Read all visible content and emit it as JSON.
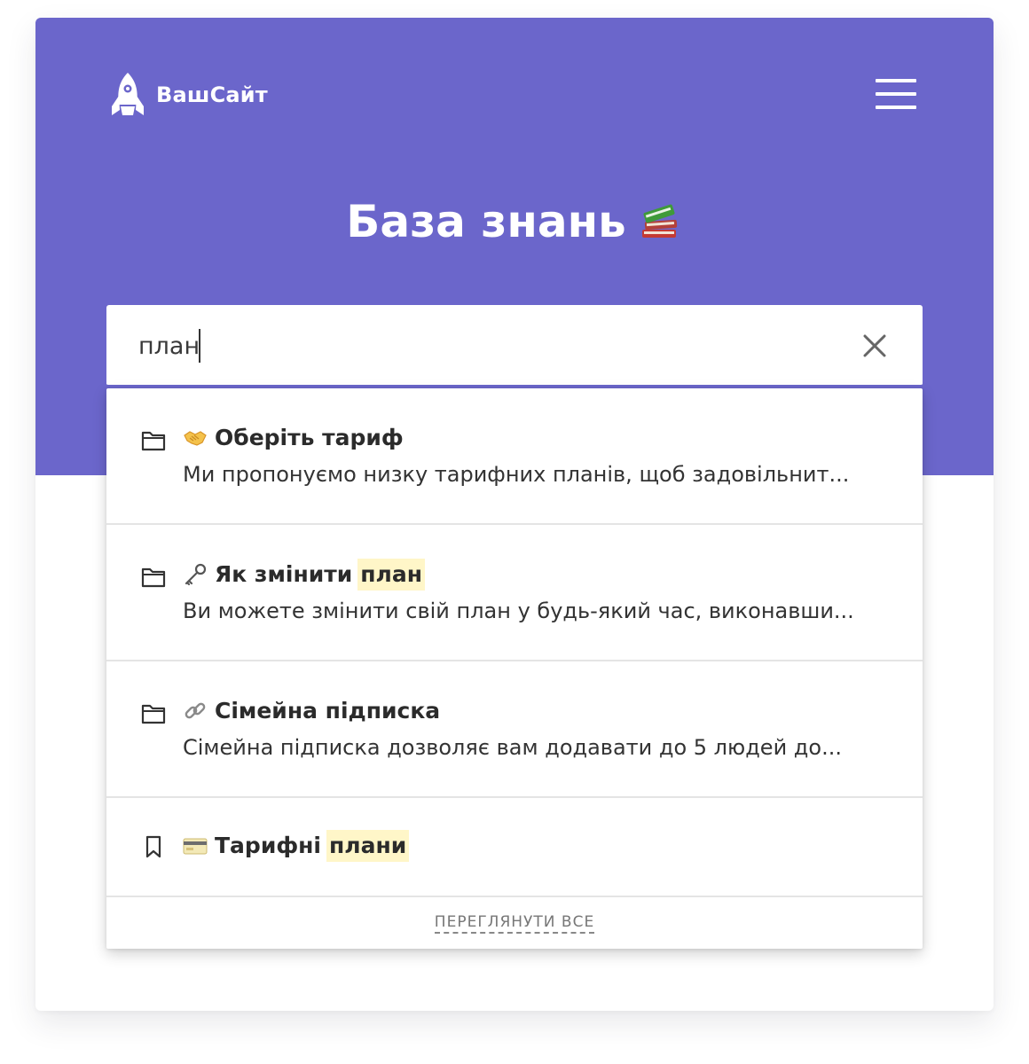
{
  "colors": {
    "brand": "#6b66cb",
    "highlight": "#fff6c8",
    "divider": "#e4e4e4"
  },
  "header": {
    "site_name": "ВашСайт",
    "logo_icon": "rocket-icon",
    "menu_icon": "hamburger-menu-icon"
  },
  "hero": {
    "title": "База знань",
    "title_icon": "books-emoji"
  },
  "search": {
    "value": "план",
    "clear_icon": "close-icon"
  },
  "results": [
    {
      "type_icon": "folder-icon",
      "emoji_icon": "handshake-emoji",
      "title": "Оберіть тариф",
      "highlight": "",
      "description": "Ми пропонуємо низку тарифних планів, щоб задовільнит..."
    },
    {
      "type_icon": "folder-icon",
      "emoji_icon": "key-emoji",
      "title": "Як змінити",
      "highlight": "план",
      "description": "Ви можете змінити свій план у будь-який час, виконавши..."
    },
    {
      "type_icon": "folder-icon",
      "emoji_icon": "link-emoji",
      "title": "Сімейна підписка",
      "highlight": "",
      "description": "Сімейна підписка дозволяє вам додавати до 5 людей до..."
    },
    {
      "type_icon": "bookmark-icon",
      "emoji_icon": "credit-card-emoji",
      "title": "Тарифні",
      "highlight": "плани",
      "description": ""
    }
  ],
  "footer": {
    "view_all_label": "ПЕРЕГЛЯНУТИ ВСЕ"
  }
}
